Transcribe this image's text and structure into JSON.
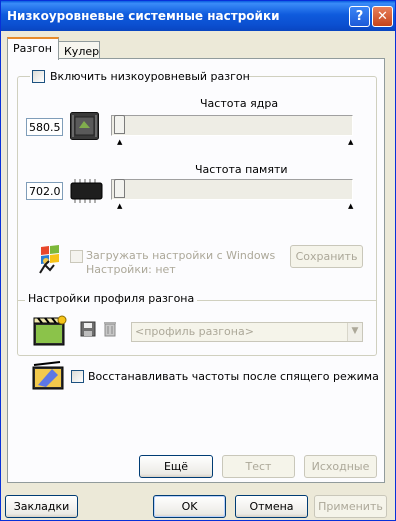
{
  "window": {
    "title": "Низкоуровневые системные настройки",
    "help_label": "?",
    "close_label": "✕"
  },
  "tabs": [
    {
      "label": "Разгон",
      "active": true
    },
    {
      "label": "Кулер",
      "active": false
    }
  ],
  "overclock": {
    "enable_label": "Включить низкоуровневый разгон",
    "enable_checked": false,
    "core": {
      "label": "Частота ядра",
      "value": "580.5",
      "slider_position": 0
    },
    "memory": {
      "label": "Частота памяти",
      "value": "702.0",
      "slider_position": 0
    },
    "load_on_windows_label": "Загружать настройки с Windows",
    "settings_status": "Настройки: нет",
    "save_label": "Сохранить"
  },
  "profile": {
    "group_label": "Настройки профиля разгона",
    "select_value": "<профиль разгона>"
  },
  "restore_after_sleep_label": "Восстанавливать частоты после спящего режима",
  "panel_buttons": {
    "more": "Ещё",
    "test": "Тест",
    "defaults": "Исходные"
  },
  "footer": {
    "bookmarks": "Закладки",
    "ok": "OK",
    "cancel": "Отмена",
    "apply": "Применить"
  },
  "colors": {
    "titlebar": "#0B4FD0",
    "face": "#ECE9D8",
    "tab_accent": "#E68B2C",
    "disabled_text": "#ACA899"
  }
}
